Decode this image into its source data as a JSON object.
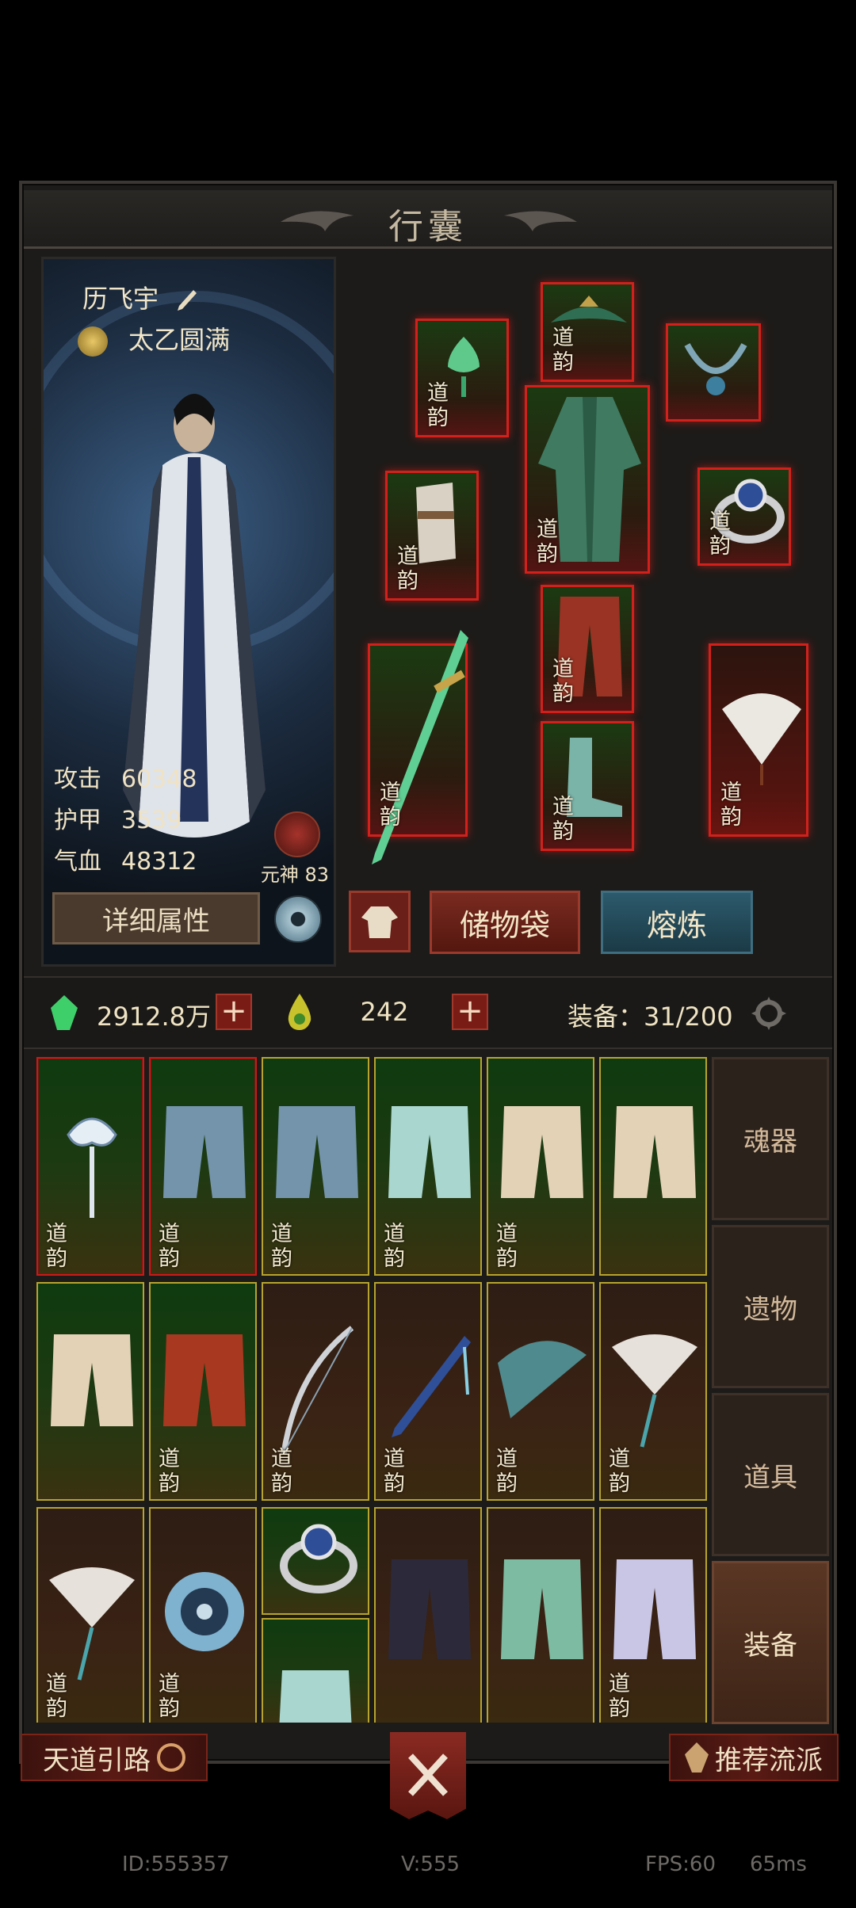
{
  "panel": {
    "title": "行囊"
  },
  "character": {
    "name": "历飞宇",
    "realm": "太乙圆满",
    "stats": [
      {
        "label": "攻击",
        "value": "60348"
      },
      {
        "label": "护甲",
        "value": "3539"
      },
      {
        "label": "气血",
        "value": "48312"
      }
    ],
    "soul_label": "元神 83"
  },
  "equip_badge": "道韵",
  "buttons": {
    "detail": "详细属性",
    "bag": "储物袋",
    "smelt": "熔炼"
  },
  "resources": {
    "spirit_stone": "2912.8万",
    "essence": "242",
    "equip_count": "装备：31/200"
  },
  "categories": [
    "魂器",
    "遗物",
    "道具",
    "装备"
  ],
  "active_category": "装备",
  "bottom": {
    "left_banner": "天道引路",
    "right_banner": "推荐流派"
  },
  "footer": {
    "id": "ID:555357",
    "version": "V:555",
    "fps": "FPS:60",
    "latency": "65ms"
  },
  "colors": {
    "equip_red": "#d2201c",
    "frame_gold": "#b7a42e",
    "smelt_teal": "#2c5a6c"
  }
}
